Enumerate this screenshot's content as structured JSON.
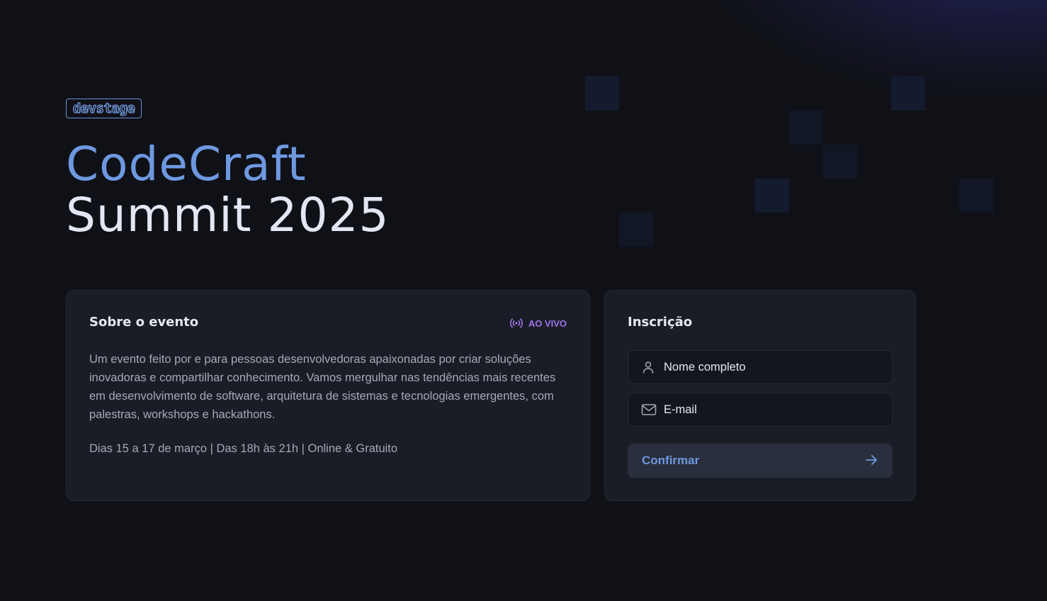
{
  "brand": {
    "logo_text": "devstage"
  },
  "hero": {
    "title_line1": "CodeCraft",
    "title_line2": "Summit 2025"
  },
  "about": {
    "heading": "Sobre o evento",
    "live_badge": "AO VIVO",
    "description": "Um evento feito por e para pessoas desenvolvedoras apaixonadas por criar soluções inovadoras e compartilhar conhecimento. Vamos mergulhar nas tendências mais recentes em desenvolvimento de software, arquitetura de sistemas e tecnologias emergentes, com palestras, workshops e hackathons.",
    "details": "Dias 15 a 17 de março | Das 18h às 21h | Online & Gratuito"
  },
  "signup": {
    "heading": "Inscrição",
    "name_placeholder": "Nome completo",
    "email_placeholder": "E-mail",
    "confirm_label": "Confirmar"
  },
  "icons": {
    "live": "radio-broadcast-icon",
    "name": "user-icon",
    "email": "mail-icon",
    "confirm": "arrow-right-icon"
  },
  "colors": {
    "background": "#0f1117",
    "card": "#1a1d26",
    "accent_blue": "#6e99e0",
    "accent_purple": "#9b74ec",
    "text_muted": "#a4a9b8"
  }
}
